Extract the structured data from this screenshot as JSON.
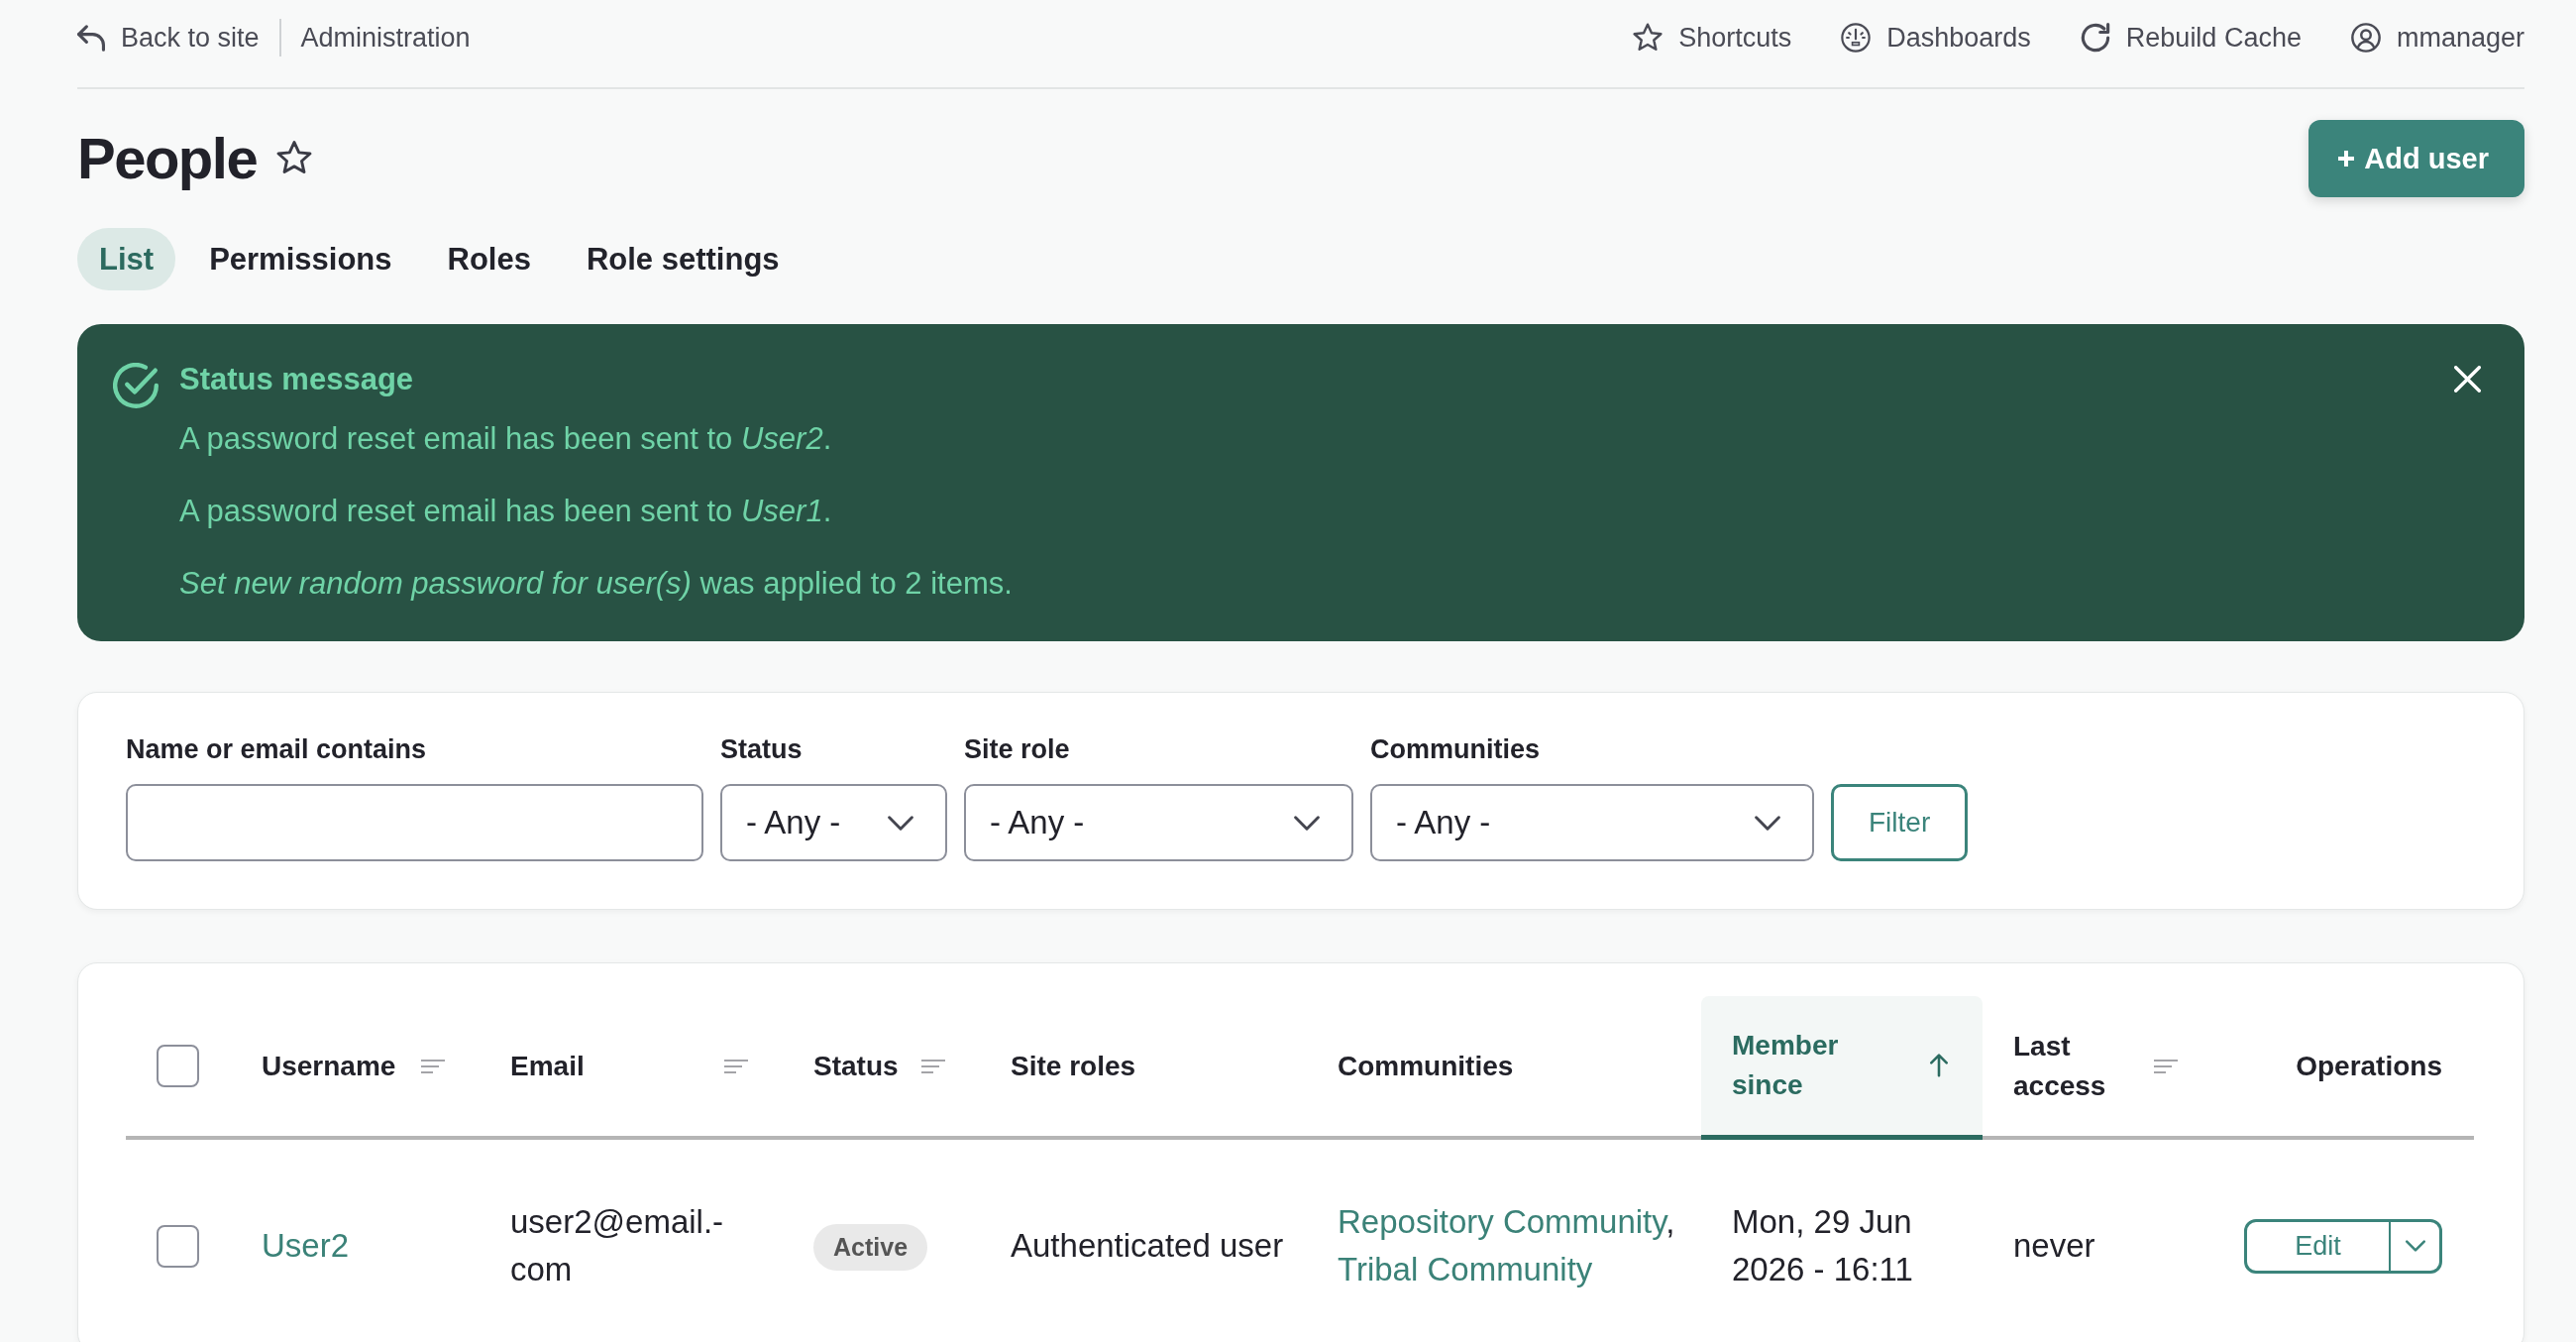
{
  "topbar": {
    "back": "Back to site",
    "section": "Administration",
    "links": [
      "Shortcuts",
      "Dashboards",
      "Rebuild Cache",
      "mmanager"
    ]
  },
  "page": {
    "title": "People",
    "favorite": false,
    "action": "Add user"
  },
  "tabs": [
    {
      "label": "List",
      "selected": true
    },
    {
      "label": "Permissions",
      "selected": false
    },
    {
      "label": "Roles",
      "selected": false
    },
    {
      "label": "Role settings",
      "selected": false
    }
  ],
  "status_message": {
    "title": "Status message",
    "messages": [
      "A password reset email has been sent to *User2*.",
      "A password reset email has been sent to *User1*.",
      "*Set new random password for user(s)* was applied to 2 items."
    ]
  },
  "filters": {
    "fields": [
      {
        "kind": "text",
        "label": "Name or email contains"
      },
      {
        "kind": "select",
        "label": "Status",
        "value": "- Any -"
      },
      {
        "kind": "select",
        "label": "Site role",
        "value": "- Any -"
      },
      {
        "kind": "select",
        "label": "Communities",
        "value": "- Any -"
      }
    ],
    "button": "Filter"
  },
  "table": {
    "select_all": {
      "checked": false
    },
    "columns": [
      {
        "label": "Username",
        "sortable": true,
        "sorted": false
      },
      {
        "label": "Email",
        "sortable": true,
        "sorted": false
      },
      {
        "label": "Status",
        "sortable": true,
        "sorted": false
      },
      {
        "label": "Site roles",
        "sortable": false,
        "sorted": false
      },
      {
        "label": "Communities",
        "sortable": false,
        "sorted": false
      },
      {
        "label": "Member since",
        "sortable": true,
        "sorted": true
      },
      {
        "label": "Last access",
        "sortable": true,
        "sorted": false
      },
      {
        "label": "Operations",
        "sortable": false,
        "sorted": false
      }
    ],
    "rows": [
      {
        "checked": false,
        "username": "User2",
        "email": "user2@email.-\ncom",
        "status": "Active",
        "site_roles": "Authenticated user",
        "communities": {
          "links": [
            "Repository Community",
            "Tribal Community"
          ],
          "separator": ","
        },
        "member_since": "Mon, 29 Jun 2026 - 16:11",
        "last_access": "never",
        "operation": "Edit"
      }
    ]
  }
}
